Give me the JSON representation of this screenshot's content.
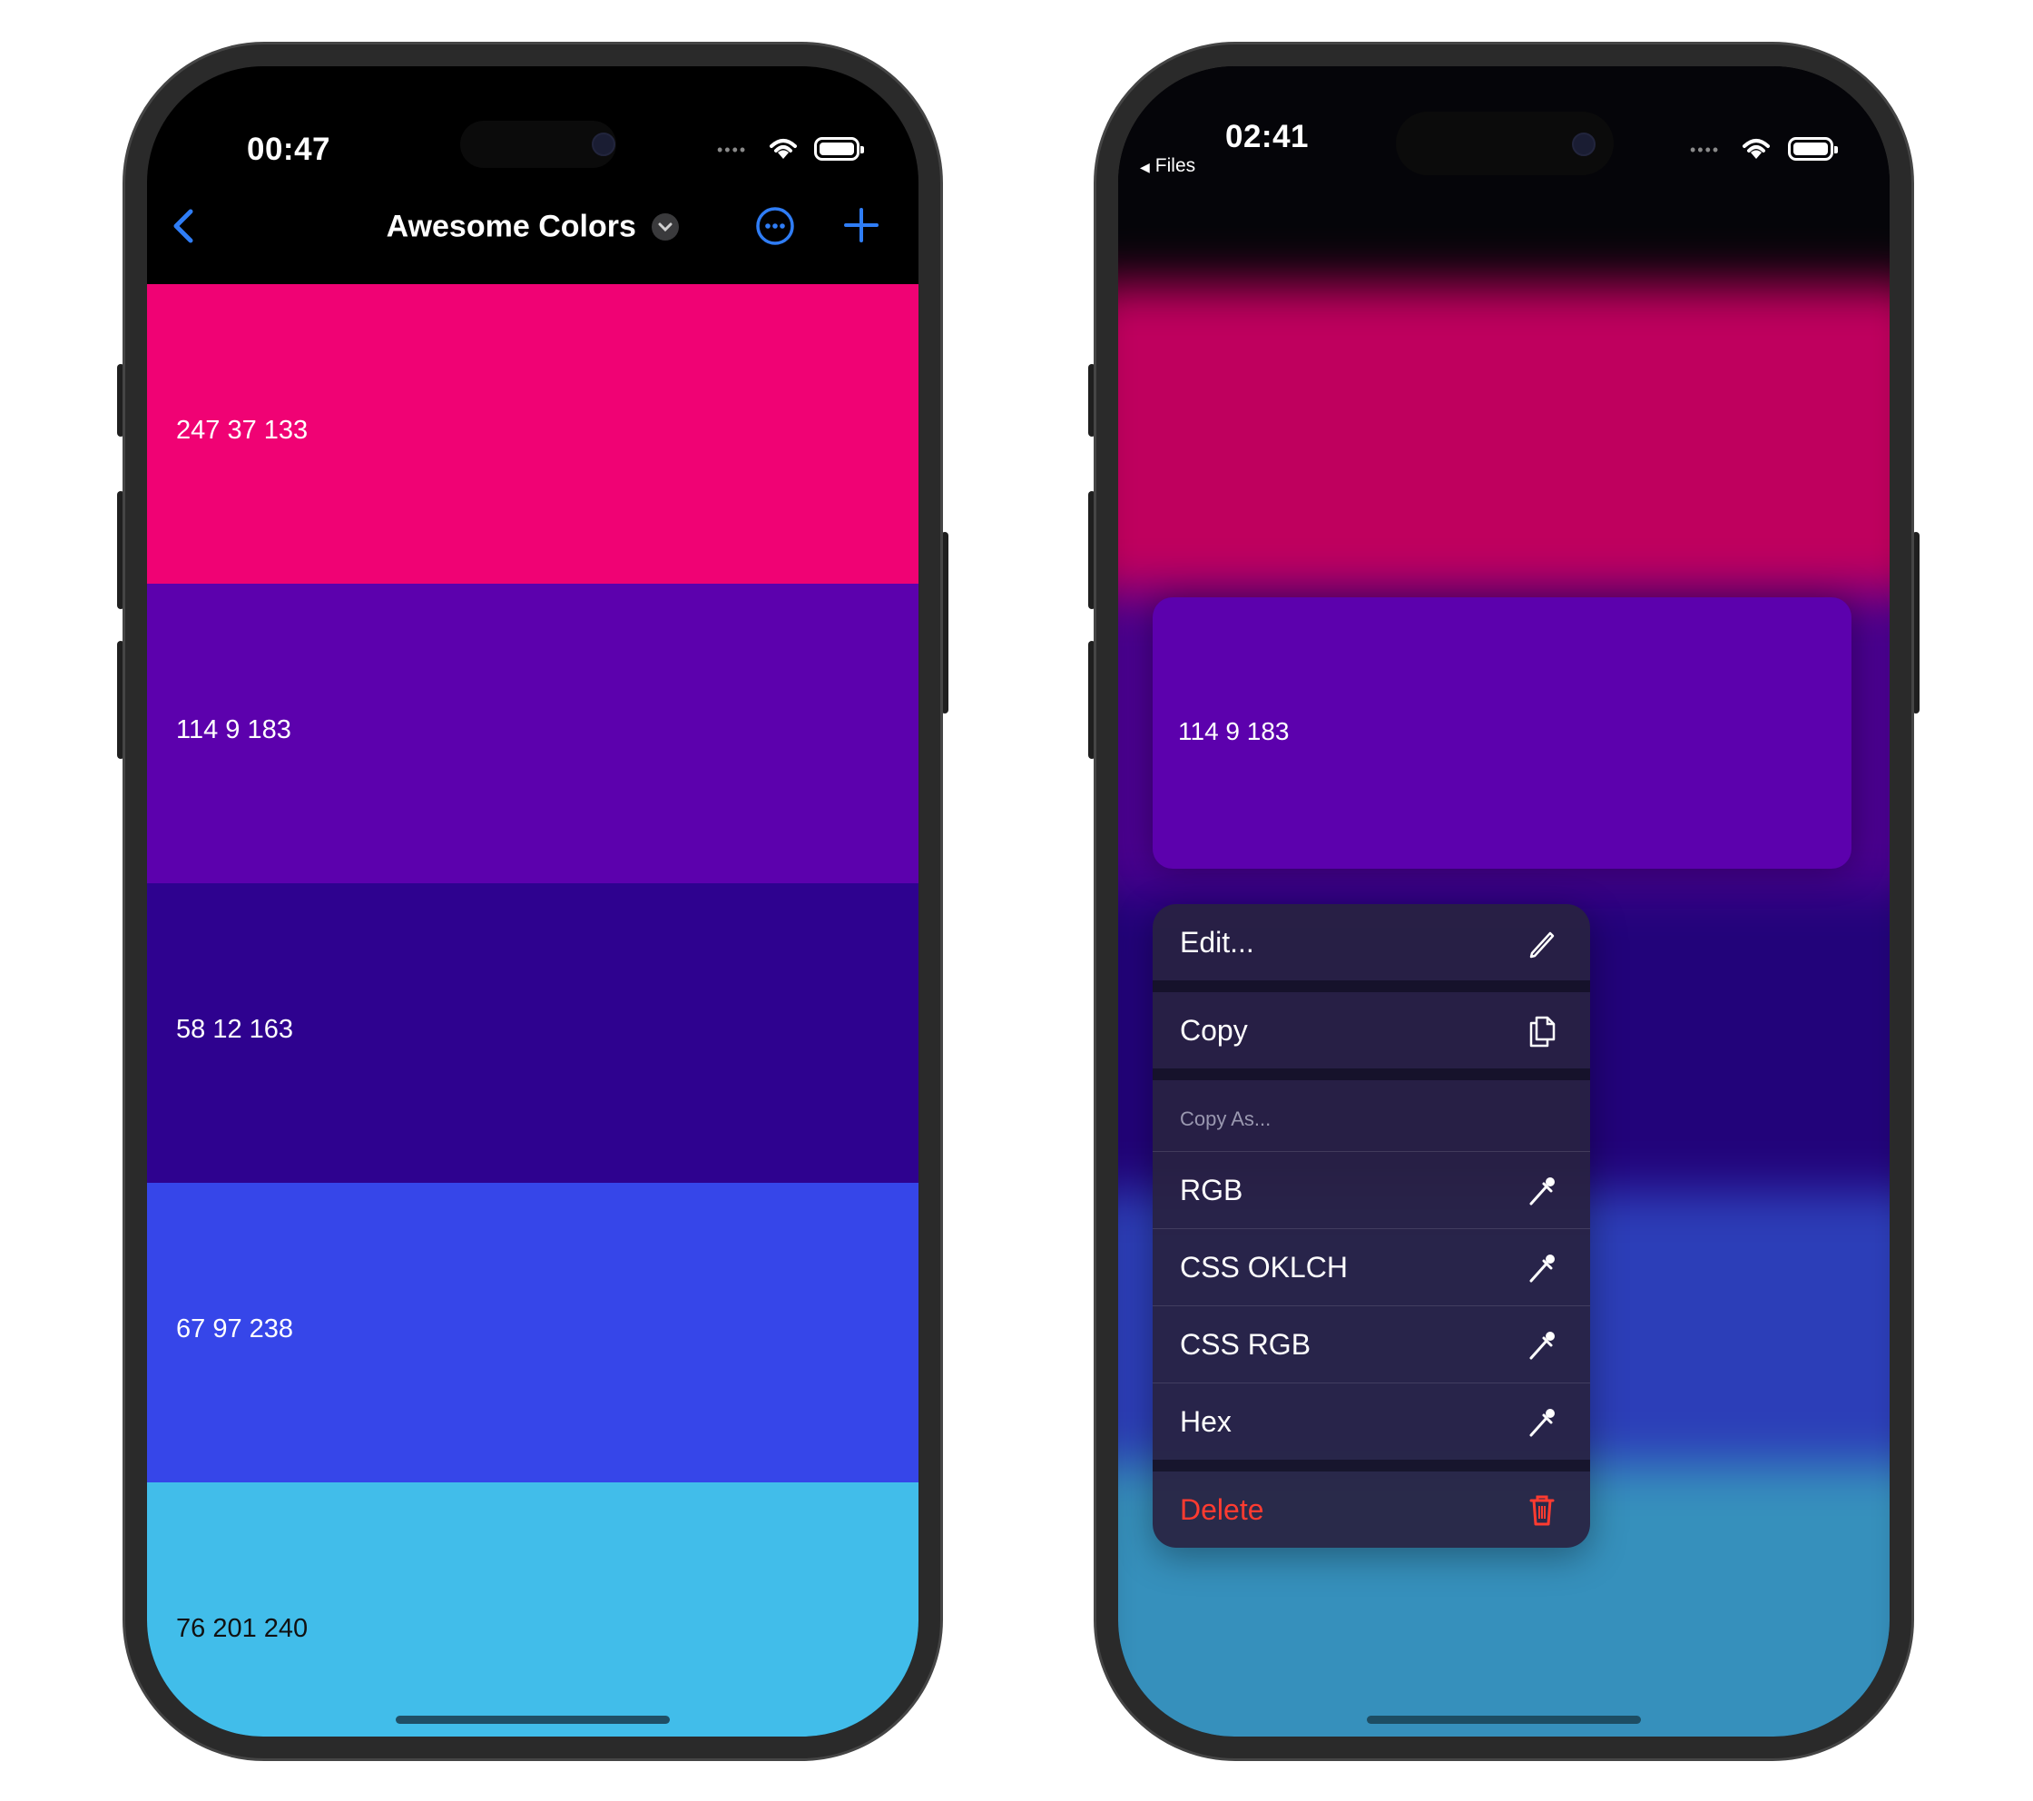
{
  "left_phone": {
    "status": {
      "time": "00:47"
    },
    "nav": {
      "title": "Awesome Colors"
    },
    "swatches": [
      {
        "label": "247 37 133",
        "color": "#f00274"
      },
      {
        "label": "114 9 183",
        "color": "#5c01ad"
      },
      {
        "label": "58 12 163",
        "color": "#2e028f"
      },
      {
        "label": "67 97 238",
        "color": "#3646e9"
      },
      {
        "label": "76 201 240",
        "color": "#41bdea"
      }
    ]
  },
  "right_phone": {
    "status": {
      "time": "02:41",
      "back_app": "Files"
    },
    "preview": {
      "label": "114 9 183",
      "color": "#5c01ad"
    },
    "context_menu": {
      "edit": "Edit...",
      "copy": "Copy",
      "copy_as_header": "Copy As...",
      "copy_as_items": [
        "RGB",
        "CSS OKLCH",
        "CSS RGB",
        "Hex"
      ],
      "delete": "Delete"
    }
  },
  "colors": {
    "accent": "#2f7df6",
    "destructive": "#ff3b30"
  }
}
